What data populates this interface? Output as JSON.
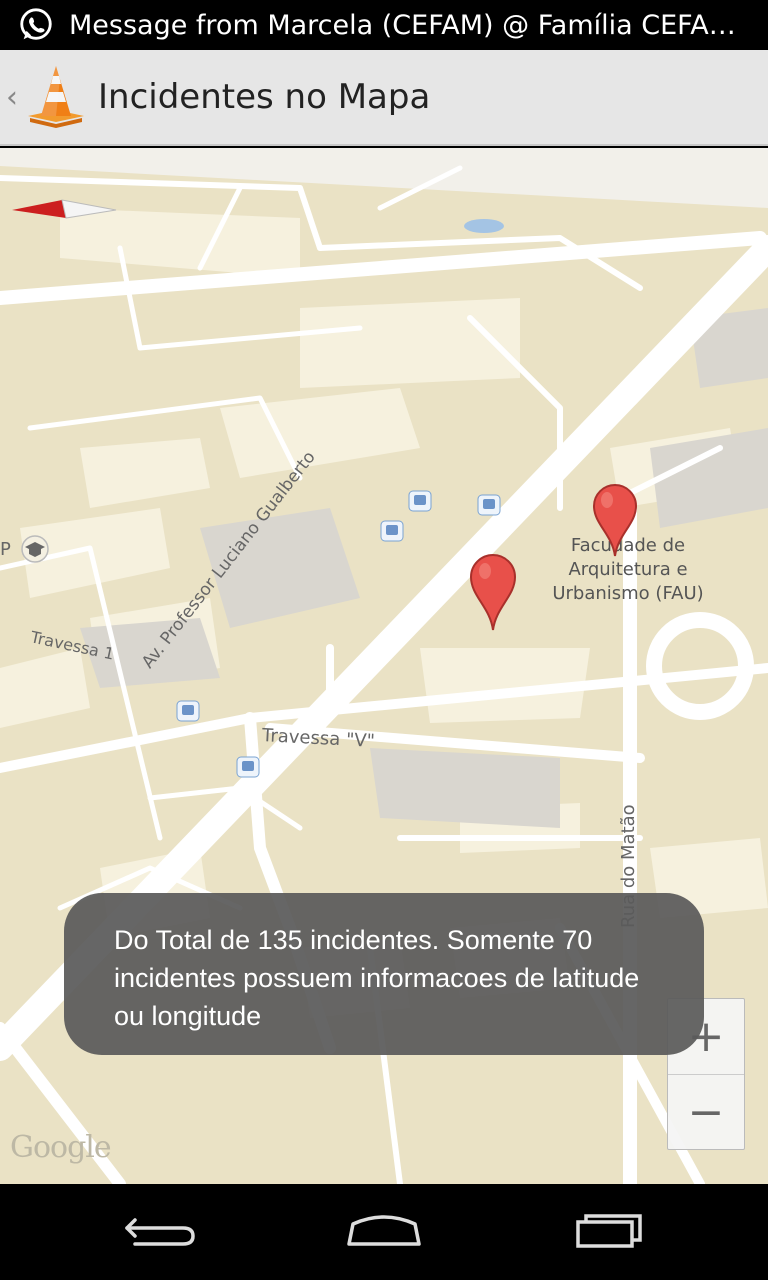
{
  "status_bar": {
    "notification_icon": "whatsapp-icon",
    "notification_text": "Message from Marcela (CEFAM) @ Família CEFAM ..."
  },
  "action_bar": {
    "up_icon": "chevron-left-icon",
    "app_icon": "traffic-cone-icon",
    "title": "Incidentes no Mapa"
  },
  "map": {
    "poi_label": "Facudade de\nArquitetura e\nUrbanismo (FAU)",
    "partial_label": "P",
    "streets": {
      "av_luciano": "Av. Professor Luciano Gualberto",
      "travessa_v": "Travessa \"V\"",
      "travessa_1": "Travessa 1",
      "rua_matao": "Rua do Matão"
    },
    "markers_visible": 2,
    "attribution": "Google",
    "zoom_in_label": "+",
    "zoom_out_label": "−",
    "marker_color": "#e8504a"
  },
  "toast": {
    "message": "Do Total de 135 incidentes. Somente 70 incidentes possuem informacoes de latitude ou longitude"
  },
  "nav_bar": {
    "back_icon": "back-icon",
    "home_icon": "home-icon",
    "recents_icon": "recents-icon"
  }
}
